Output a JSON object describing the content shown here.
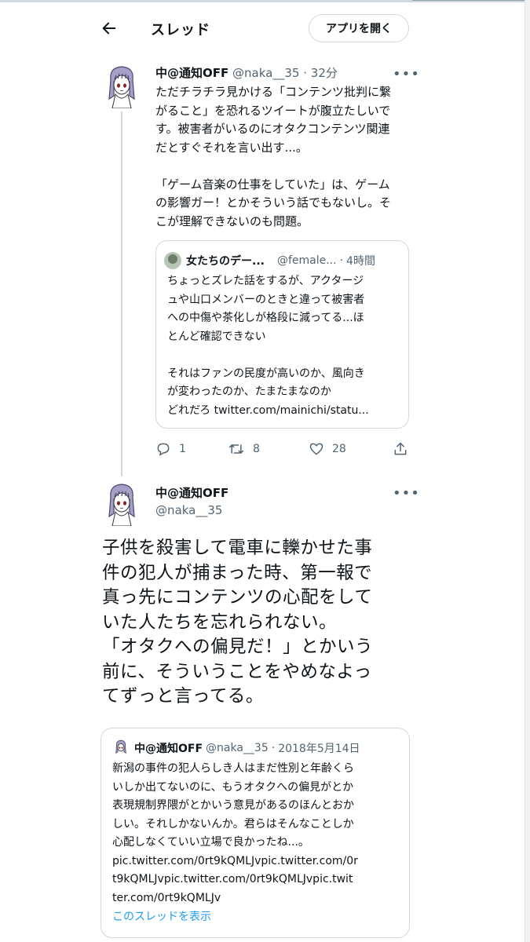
{
  "header": {
    "title": "スレッド",
    "open_app_label": "アプリを開く"
  },
  "tweet1": {
    "name": "中@通知OFF",
    "handle": "@naka__35",
    "sep": "·",
    "time": "32分",
    "more": "•••",
    "body_lines": [
      "ただチラチラ見かける「コンテンツ批判に繋",
      "がること」を恐れるツイートが腹立たしいで",
      "す。被害者がいるのにオタクコンテンツ関連",
      "だとすぐそれを言い出す...。",
      "",
      "「ゲーム音楽の仕事をしていた」は、ゲーム",
      "の影響ガー！とかそういう話でもないし。そ",
      "こが理解できないのも問題。"
    ],
    "quote": {
      "name": "女たちのデー...",
      "handle": "@female...",
      "sep": "·",
      "time": "4時間",
      "body_lines": [
        "ちょっとズレた話をするが、アクタージ",
        "ュや山口メンバーのときと違って被害者",
        "への中傷や茶化しが格段に減ってる...ほ",
        "とんど確認できない",
        "",
        "それはファンの民度が高いのか、風向き",
        "が変わったのか、たまたまなのか",
        "どれだろ twitter.com/mainichi/statu..."
      ]
    },
    "actions": {
      "reply_count": "1",
      "retweet_count": "8",
      "like_count": "28"
    }
  },
  "tweet2": {
    "name": "中@通知OFF",
    "handle": "@naka__35",
    "more": "•••",
    "body_lines": [
      "子供を殺害して電車に轢かせた事",
      "件の犯人が捕まった時、第一報で",
      "真っ先にコンテンツの心配をして",
      "いた人たちを忘れられない。",
      "「オタクへの偏見だ！」とかいう",
      "前に、そういうことをやめなよっ",
      "てずっと言ってる。"
    ],
    "quote": {
      "name": "中@通知OFF",
      "handle": "@naka__35",
      "sep": "·",
      "time": "2018年5月14日",
      "body_lines": [
        "新潟の事件の犯人らしき人はまだ性別と年齢くら",
        "いしか出てないのに、もうオタクへの偏見がとか",
        "表現規制界隈がとかいう意見があるのほんとおか",
        "しい。それしかないんか。君らはそんなことしか",
        "心配しなくていい立場で良かったね...。",
        "pic.twitter.com/0rt9kQMLJvpic.twitter.com/0r",
        "t9kQMLJvpic.twitter.com/0rt9kQMLJvpic.twit",
        "ter.com/0rt9kQMLJv"
      ],
      "show_thread": "このスレッドを表示"
    }
  },
  "colors": {
    "text": "#0f1419",
    "muted": "#536471",
    "link": "#1d9bf0",
    "border": "#cfd9de"
  },
  "icons": [
    "back-arrow-icon",
    "more-icon",
    "reply-icon",
    "retweet-icon",
    "like-icon",
    "share-icon",
    "avatar"
  ]
}
